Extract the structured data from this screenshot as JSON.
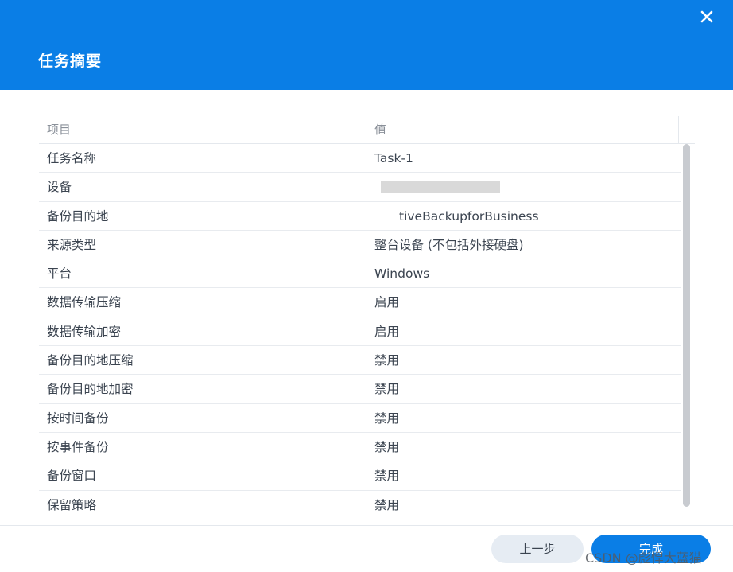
{
  "dialog": {
    "title": "任务摘要",
    "close_icon": "close-icon"
  },
  "table": {
    "headers": [
      "项目",
      "值"
    ],
    "rows": [
      {
        "key": "任务名称",
        "value": "Task-1"
      },
      {
        "key": "设备",
        "value": ""
      },
      {
        "key": "备份目的地",
        "value": "tiveBackupforBusiness"
      },
      {
        "key": "来源类型",
        "value": "整台设备 (不包括外接硬盘)"
      },
      {
        "key": "平台",
        "value": "Windows"
      },
      {
        "key": "数据传输压缩",
        "value": "启用"
      },
      {
        "key": "数据传输加密",
        "value": "启用"
      },
      {
        "key": "备份目的地压缩",
        "value": "禁用"
      },
      {
        "key": "备份目的地加密",
        "value": "禁用"
      },
      {
        "key": "按时间备份",
        "value": "禁用"
      },
      {
        "key": "按事件备份",
        "value": "禁用"
      },
      {
        "key": "备份窗口",
        "value": "禁用"
      },
      {
        "key": "保留策略",
        "value": "禁用"
      }
    ]
  },
  "footer": {
    "back_label": "上一步",
    "done_label": "完成"
  },
  "watermark": "CSDN @彪悍大蓝猫",
  "colors": {
    "header_bg": "#0a7ee6",
    "primary_button": "#0a7ee6",
    "secondary_button": "#e6ecf3"
  }
}
